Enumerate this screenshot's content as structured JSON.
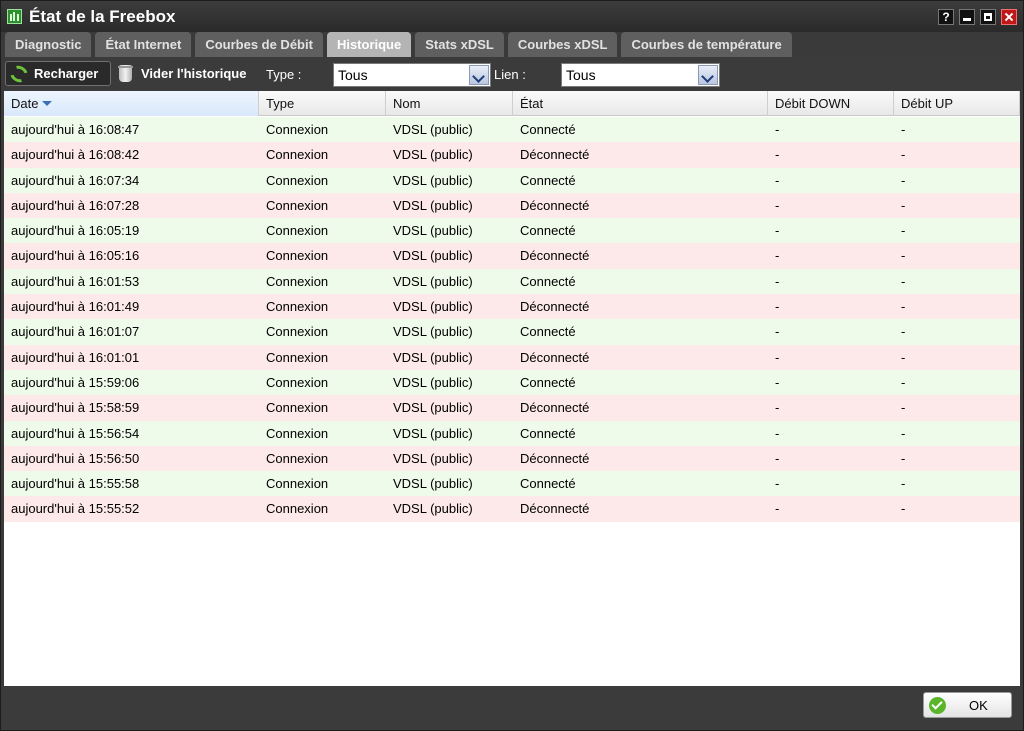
{
  "window": {
    "title": "État de la Freebox"
  },
  "tabs": [
    {
      "label": "Diagnostic",
      "active": false
    },
    {
      "label": "État Internet",
      "active": false
    },
    {
      "label": "Courbes de Débit",
      "active": false
    },
    {
      "label": "Historique",
      "active": true
    },
    {
      "label": "Stats xDSL",
      "active": false
    },
    {
      "label": "Courbes xDSL",
      "active": false
    },
    {
      "label": "Courbes de température",
      "active": false
    }
  ],
  "toolbar": {
    "reload_label": "Recharger",
    "clear_label": "Vider l'historique",
    "type_label": "Type :",
    "type_value": "Tous",
    "link_label": "Lien :",
    "link_value": "Tous"
  },
  "table": {
    "columns": [
      "Date",
      "Type",
      "Nom",
      "État",
      "Débit DOWN",
      "Débit UP"
    ],
    "rows": [
      [
        "aujourd'hui à 16:08:47",
        "Connexion",
        "VDSL (public)",
        "Connecté",
        "-",
        "-"
      ],
      [
        "aujourd'hui à 16:08:42",
        "Connexion",
        "VDSL (public)",
        "Déconnecté",
        "-",
        "-"
      ],
      [
        "aujourd'hui à 16:07:34",
        "Connexion",
        "VDSL (public)",
        "Connecté",
        "-",
        "-"
      ],
      [
        "aujourd'hui à 16:07:28",
        "Connexion",
        "VDSL (public)",
        "Déconnecté",
        "-",
        "-"
      ],
      [
        "aujourd'hui à 16:05:19",
        "Connexion",
        "VDSL (public)",
        "Connecté",
        "-",
        "-"
      ],
      [
        "aujourd'hui à 16:05:16",
        "Connexion",
        "VDSL (public)",
        "Déconnecté",
        "-",
        "-"
      ],
      [
        "aujourd'hui à 16:01:53",
        "Connexion",
        "VDSL (public)",
        "Connecté",
        "-",
        "-"
      ],
      [
        "aujourd'hui à 16:01:49",
        "Connexion",
        "VDSL (public)",
        "Déconnecté",
        "-",
        "-"
      ],
      [
        "aujourd'hui à 16:01:07",
        "Connexion",
        "VDSL (public)",
        "Connecté",
        "-",
        "-"
      ],
      [
        "aujourd'hui à 16:01:01",
        "Connexion",
        "VDSL (public)",
        "Déconnecté",
        "-",
        "-"
      ],
      [
        "aujourd'hui à 15:59:06",
        "Connexion",
        "VDSL (public)",
        "Connecté",
        "-",
        "-"
      ],
      [
        "aujourd'hui à 15:58:59",
        "Connexion",
        "VDSL (public)",
        "Déconnecté",
        "-",
        "-"
      ],
      [
        "aujourd'hui à 15:56:54",
        "Connexion",
        "VDSL (public)",
        "Connecté",
        "-",
        "-"
      ],
      [
        "aujourd'hui à 15:56:50",
        "Connexion",
        "VDSL (public)",
        "Déconnecté",
        "-",
        "-"
      ],
      [
        "aujourd'hui à 15:55:58",
        "Connexion",
        "VDSL (public)",
        "Connecté",
        "-",
        "-"
      ],
      [
        "aujourd'hui à 15:55:52",
        "Connexion",
        "VDSL (public)",
        "Déconnecté",
        "-",
        "-"
      ]
    ]
  },
  "footer": {
    "ok_label": "OK"
  },
  "colors": {
    "row_connected": "#effbea",
    "row_disconnected": "#fde9e9",
    "titlebar": "#2a2a2a",
    "active_tab": "#b4b4b4"
  }
}
